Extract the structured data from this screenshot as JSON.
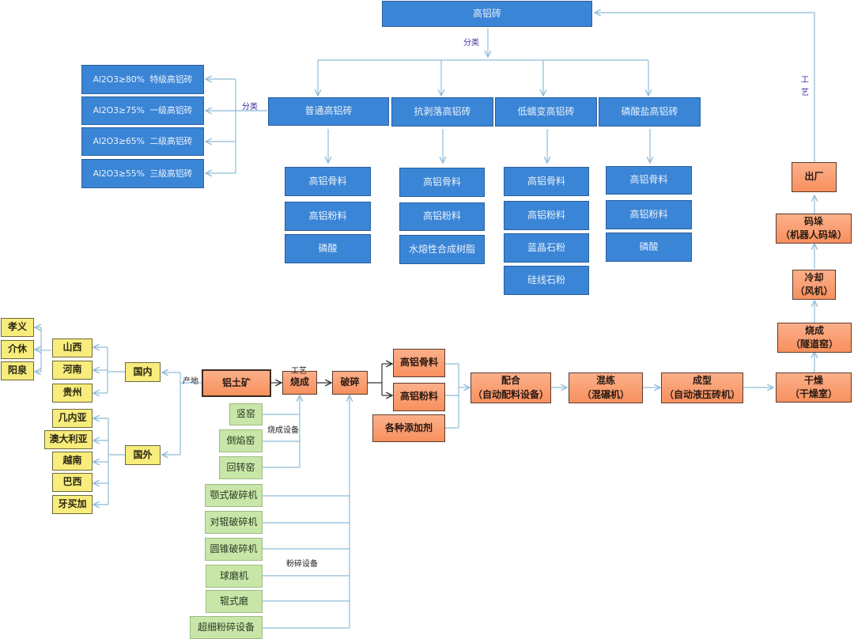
{
  "title": "高铝砖",
  "labels": {
    "classify_top": "分类",
    "classify_left": "分类",
    "process_right_1": "工",
    "process_right_2": "艺",
    "process_mid": "工艺",
    "origin": "产地",
    "firing_equipment": "烧成设备",
    "crushing_equipment": "粉碎设备"
  },
  "categories": [
    {
      "name": "普通高铝砖",
      "components": [
        "高铝骨料",
        "高铝粉料",
        "磷酸"
      ]
    },
    {
      "name": "抗剥落高铝砖",
      "components": [
        "高铝骨料",
        "高铝粉料",
        "水熔性合成树脂"
      ]
    },
    {
      "name": "低蠕变高铝砖",
      "components": [
        "高铝骨料",
        "高铝粉料",
        "蓝晶石粉",
        "硅线石粉"
      ]
    },
    {
      "name": "磷酸盐高铝砖",
      "components": [
        "高铝骨料",
        "高铝粉料",
        "磷酸"
      ]
    }
  ],
  "grades": [
    "Al2O3≥80%  特级高铝砖",
    "Al2O3≥75%  一级高铝砖",
    "Al2O3≥65%  二级高铝砖",
    "Al2O3≥55%  三级高铝砖"
  ],
  "origins": {
    "domestic": {
      "name": "国内",
      "provinces": [
        "山西",
        "河南",
        "贵州"
      ],
      "shanxi_cities": [
        "孝义",
        "介休",
        "阳泉"
      ]
    },
    "foreign": {
      "name": "国外",
      "countries": [
        "几内亚",
        "澳大利亚",
        "越南",
        "巴西",
        "牙买加"
      ]
    }
  },
  "process": {
    "raw": "铝土矿",
    "firing": "烧成",
    "crushing": "破碎",
    "aggregate": "高铝骨料",
    "powder": "高铝粉料",
    "additives": "各种添加剂",
    "batching": {
      "name": "配合",
      "equipment": "（自动配料设备）"
    },
    "mixing": {
      "name": "混练",
      "equipment": "（混碾机）"
    },
    "forming": {
      "name": "成型",
      "equipment": "（自动液压砖机）"
    },
    "drying": {
      "name": "干燥",
      "equipment": "（干燥室）"
    },
    "sintering": {
      "name": "烧成",
      "equipment": "（隧道窑）"
    },
    "cooling": {
      "name": "冷却",
      "equipment": "（风机）"
    },
    "stacking": {
      "name": "码垛",
      "equipment": "（机器人码垛）"
    },
    "shipping": "出厂"
  },
  "kilns": [
    "竖窑",
    "倒焰窑",
    "回转窑"
  ],
  "crushers": [
    "颚式破碎机",
    "对辊破碎机",
    "圆锥破碎机",
    "球磨机",
    "辊式磨",
    "超细粉碎设备"
  ],
  "colors": {
    "blue": "#3a85d6",
    "orange": "#f7905e",
    "green": "#c8e6a8",
    "yellow": "#f7ec7c",
    "connector": "#8fbcd8",
    "label_purple": "#3b2fa0"
  }
}
